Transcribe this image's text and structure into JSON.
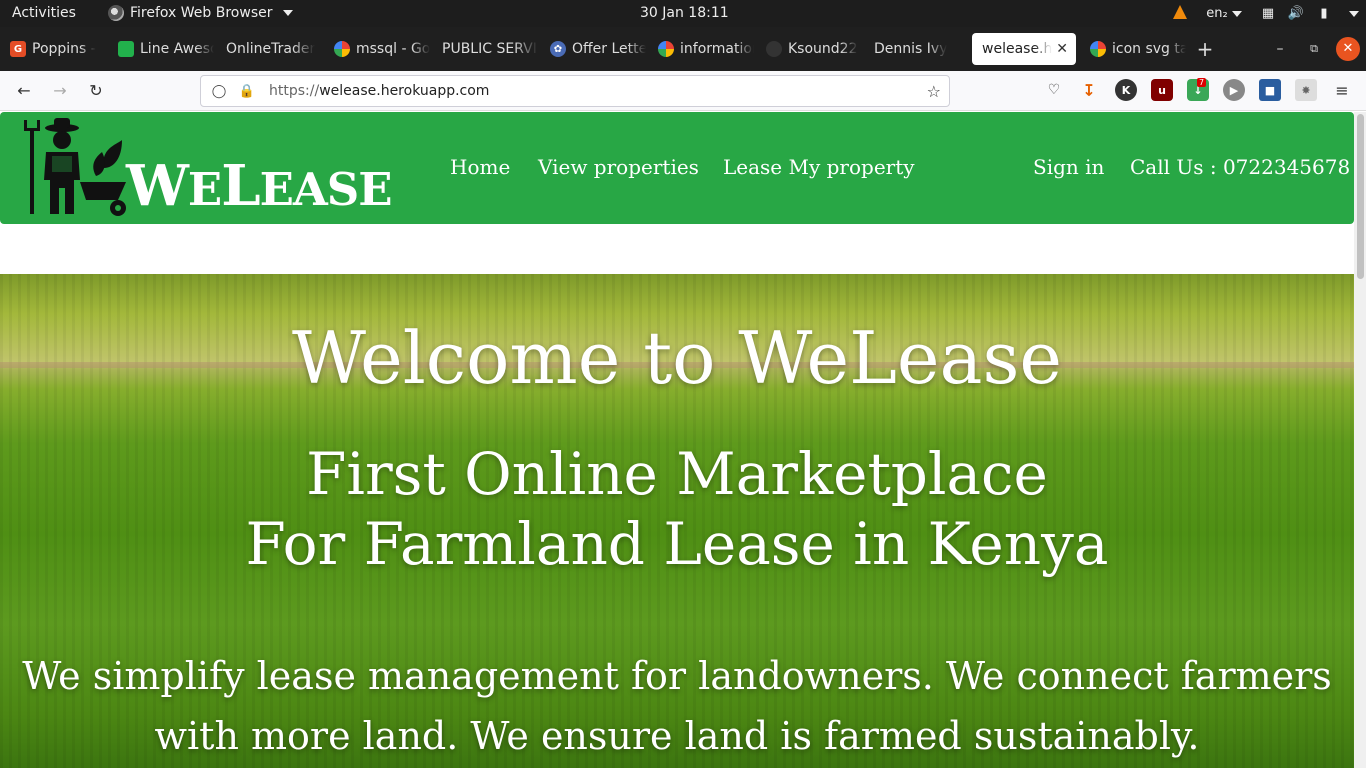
{
  "system": {
    "activities": "Activities",
    "app_menu": "Firefox Web Browser",
    "clock": "30 Jan  18:11",
    "language": "en₂"
  },
  "tabs": [
    {
      "label": "Poppins -",
      "icon": "figma-like-icon",
      "color": "#e44d26"
    },
    {
      "label": "Line Awesome",
      "icon": "line-awesome-icon",
      "color": "#22b14c"
    },
    {
      "label": "OnlineTrader",
      "icon": "none"
    },
    {
      "label": "mssql - Google",
      "icon": "google-icon"
    },
    {
      "label": "PUBLIC SERVICE",
      "icon": "none"
    },
    {
      "label": "Offer Letter",
      "icon": "paw-icon"
    },
    {
      "label": "information",
      "icon": "google-icon"
    },
    {
      "label": "Ksound22",
      "icon": "github-icon"
    },
    {
      "label": "Dennis Ivy",
      "icon": "none"
    },
    {
      "label": "welease.herokuapp",
      "icon": "none",
      "active": true
    },
    {
      "label": "icon svg tags",
      "icon": "google-icon"
    }
  ],
  "toolbar": {
    "url_scheme": "https://",
    "url_host": "welease.herokuapp.com",
    "ublock_badge": "7"
  },
  "site": {
    "brand_big_w": "W",
    "brand_e": "E",
    "brand_big_l": "L",
    "brand_ease": "EASE",
    "nav": {
      "home": "Home",
      "view_properties": "View properties",
      "lease": "Lease My property",
      "signin": "Sign in",
      "call": "Call Us : 0722345678"
    },
    "hero": {
      "title": "Welcome to WeLease",
      "sub_line1": "First Online Marketplace",
      "sub_line2": "For Farmland Lease in Kenya",
      "desc_line1": "We simplify lease management for landowners. We connect farmers",
      "desc_line2": "with more land. We ensure land is farmed sustainably."
    }
  }
}
